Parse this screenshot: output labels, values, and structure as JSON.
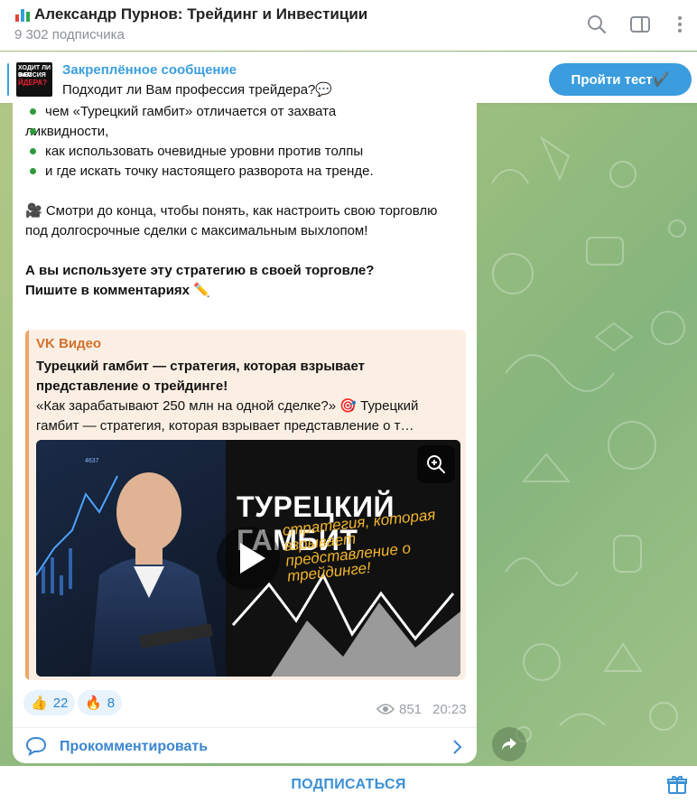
{
  "header": {
    "title": "Александр Пурнов: Трейдинг и Инвестиции",
    "subscribers": "9 302 подписчика"
  },
  "pinned": {
    "label": "Закреплённое сообщение",
    "text": "Подходит ли Вам профессия трейдера?💬",
    "thumb_lines": [
      "ХОДИТ ЛИ ВАМ",
      "ФЕССИЯ",
      "ЙДЕРА?"
    ],
    "button": "Пройти тест✔️"
  },
  "message": {
    "bullets": [
      "чем «Турецкий гамбит» отличается от захвата",
      "ликвидности,",
      "как использовать очевидные уровни против толпы",
      "и где искать точку настоящего разворота на тренде."
    ],
    "paragraph": "🎥 Смотри до конца, чтобы понять, как настроить свою торговлю под долгосрочные сделки с максимальным выхлопом!",
    "question_line1": "А вы используете эту стратегию в своей торговле?",
    "question_line2": "Пишите в комментариях ✏️"
  },
  "preview": {
    "site": "VK Видео",
    "title": "Турецкий гамбит — стратегия, которая взрывает представление о трейдинге!",
    "description": "«Как зарабатывают 250 млн на одной сделке?» 🎯 Турецкий гамбит — стратегия, которая взрывает представление о т…",
    "video_title": "ТУРЕЦКИЙ ГАМБИТ",
    "video_subtitle": "стратегия, которая взрывает представление о трейдинге!",
    "video_tick": "4637"
  },
  "reactions": [
    {
      "emoji": "👍",
      "count": "22"
    },
    {
      "emoji": "🔥",
      "count": "8"
    }
  ],
  "meta": {
    "views": "851",
    "time": "20:23"
  },
  "comments": {
    "label": "Прокомментировать"
  },
  "bottom": {
    "subscribe": "ПОДПИСАТЬСЯ"
  },
  "colors": {
    "accent": "#3b9cde",
    "preview_accent": "#d4712b",
    "bullet": "#2e9b3b"
  }
}
